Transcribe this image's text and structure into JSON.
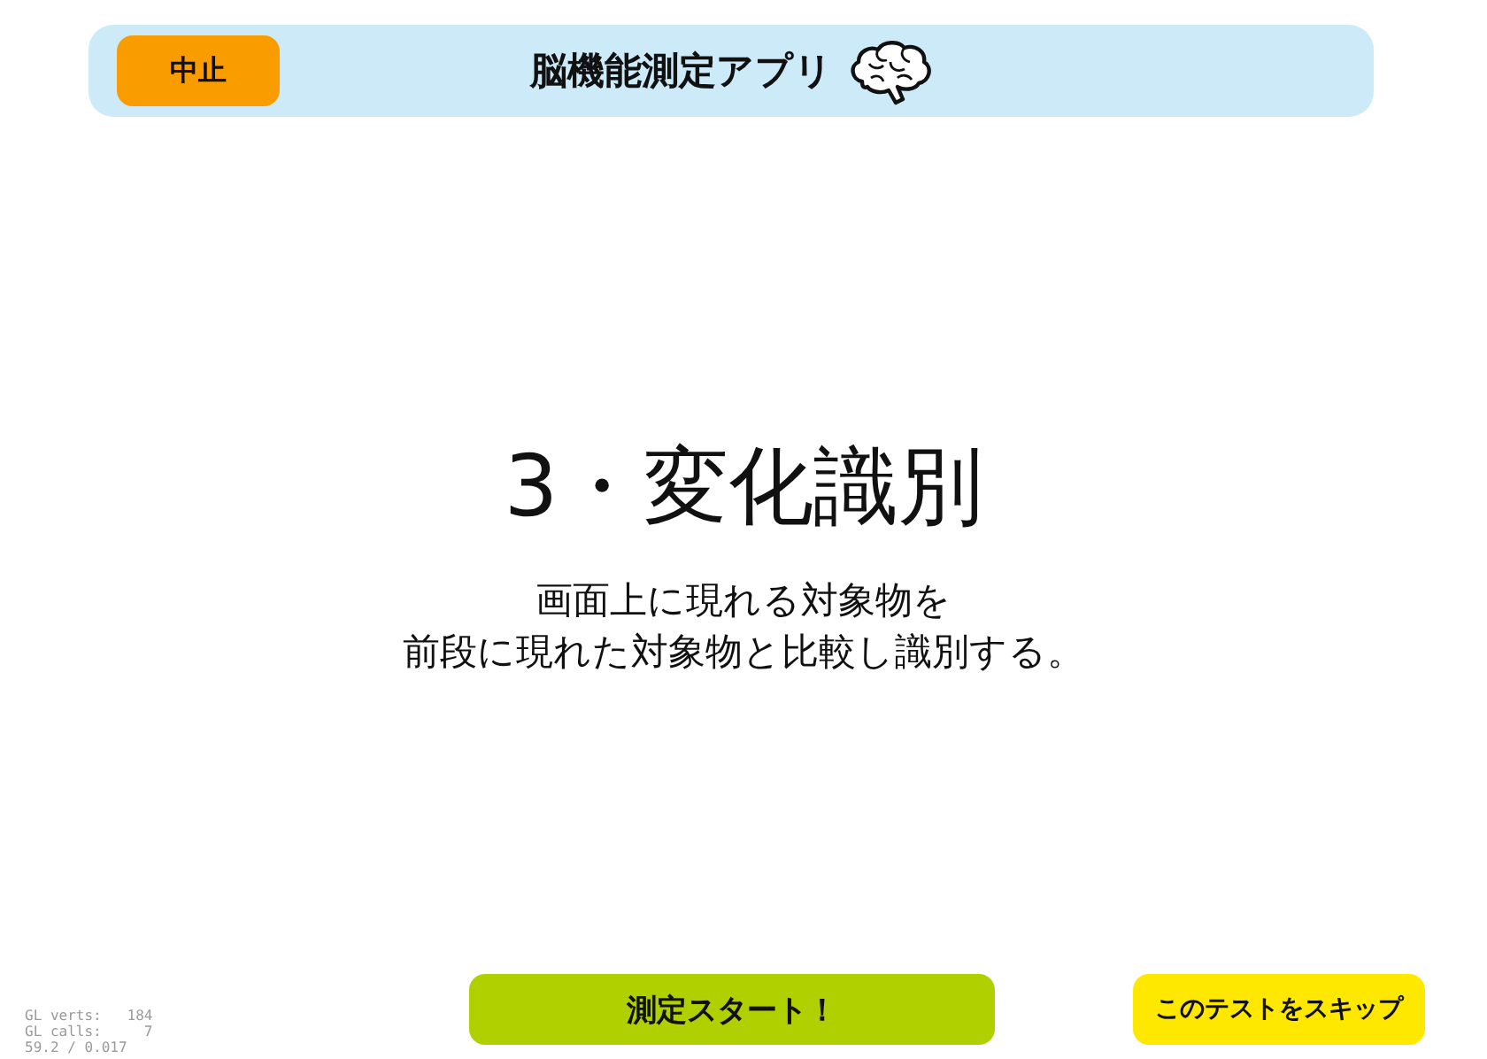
{
  "header": {
    "abort_button": "中止",
    "title": "脳機能測定アプリ"
  },
  "test": {
    "heading": "3・変化識別",
    "description": [
      "画面上に現れる対象物を",
      "前段に現れた対象物と比較し識別する。"
    ]
  },
  "debug_stats": [
    "GL verts:   184",
    "GL calls:     7",
    "59.2 / 0.017"
  ],
  "buttons": [
    {
      "kind": "start",
      "label": "測定スタート！"
    },
    {
      "kind": "skip",
      "label": "このテストをスキップ"
    }
  ]
}
